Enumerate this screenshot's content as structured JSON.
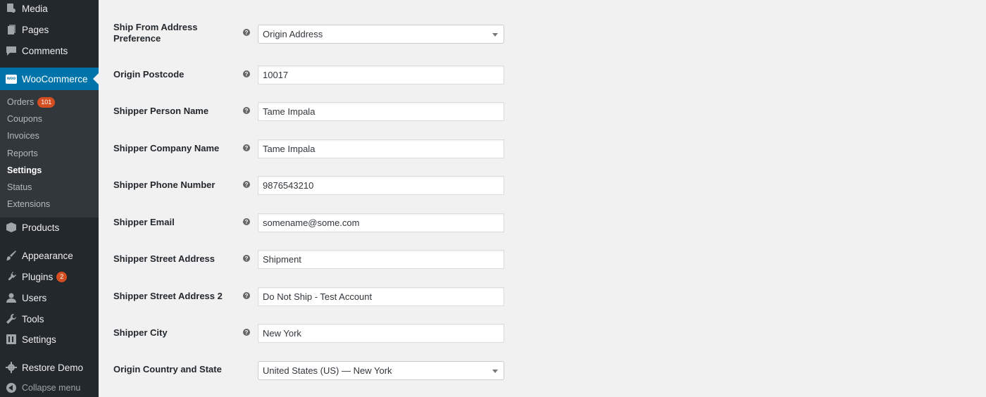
{
  "sidebar": {
    "media": "Media",
    "pages": "Pages",
    "comments": "Comments",
    "woocommerce": "WooCommerce",
    "woo_icon_text": "woo",
    "submenu": {
      "orders": "Orders",
      "orders_count": "101",
      "coupons": "Coupons",
      "invoices": "Invoices",
      "reports": "Reports",
      "settings": "Settings",
      "status": "Status",
      "extensions": "Extensions"
    },
    "products": "Products",
    "appearance": "Appearance",
    "plugins": "Plugins",
    "plugins_count": "2",
    "users": "Users",
    "tools": "Tools",
    "settings": "Settings",
    "restore_demo": "Restore Demo",
    "collapse": "Collapse menu"
  },
  "form": {
    "help_glyph": "?",
    "ship_from": {
      "label": "Ship From Address Preference",
      "value": "Origin Address"
    },
    "postcode": {
      "label": "Origin Postcode",
      "value": "10017"
    },
    "person_name": {
      "label": "Shipper Person Name",
      "value": "Tame Impala"
    },
    "company_name": {
      "label": "Shipper Company Name",
      "value": "Tame Impala"
    },
    "phone": {
      "label": "Shipper Phone Number",
      "value": "9876543210"
    },
    "email": {
      "label": "Shipper Email",
      "value": "somename@some.com"
    },
    "street": {
      "label": "Shipper Street Address",
      "value": "Shipment"
    },
    "street2": {
      "label": "Shipper Street Address 2",
      "value": "Do Not Ship - Test Account"
    },
    "city": {
      "label": "Shipper City",
      "value": "New York"
    },
    "country_state": {
      "label": "Origin Country and State",
      "value": "United States (US) — New York"
    }
  },
  "colors": {
    "sidebar_bg": "#23282d",
    "submenu_bg": "#32373c",
    "active_bg": "#0073aa",
    "badge": "#d54e21",
    "page_bg": "#f1f1f1"
  }
}
